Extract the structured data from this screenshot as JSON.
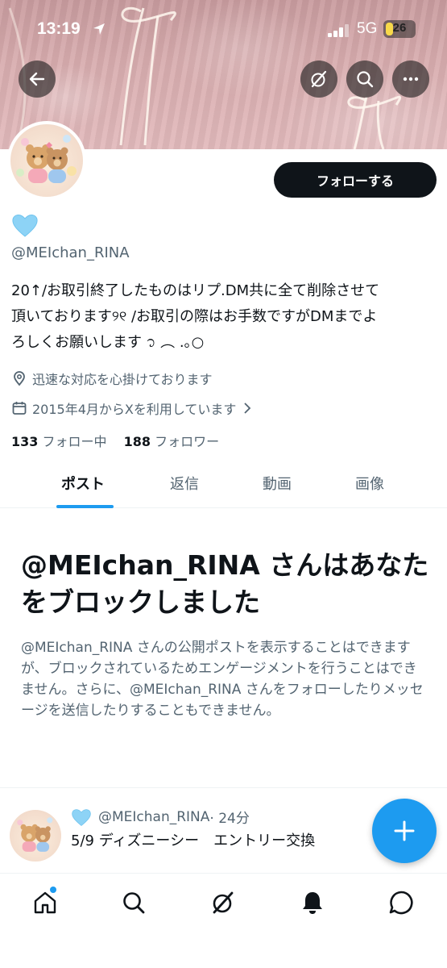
{
  "status_bar": {
    "time": "13:19",
    "network": "5G",
    "battery": "26",
    "battery_level": 0.26
  },
  "header": {
    "back_icon": "arrow-left-icon",
    "actions": [
      "grok-icon",
      "search-icon",
      "more-icon"
    ]
  },
  "profile": {
    "follow_label": "フォローする",
    "emoji": "💙",
    "handle": "@MEIchan_RINA",
    "bio_lines": [
      "20↑/お取引終了したものはリプ.DM共に全て削除させて",
      "頂いております୨୧ /お取引の際はお手数ですがDMまでよ",
      "ろしくお願いします ᭡ ︵ .｡○"
    ],
    "location": "迅速な対応を心掛けております",
    "joined": "2015年4月からXを利用しています",
    "following_count": "133",
    "following_label": "フォロー中",
    "followers_count": "188",
    "followers_label": "フォロワー"
  },
  "tabs": [
    "ポスト",
    "返信",
    "動画",
    "画像"
  ],
  "blocked": {
    "title": "@MEIchan_RINA さんはあなたをブロックしました",
    "description": "@MEIchan_RINA さんの公開ポストを表示することはできますが、ブロックされているためエンゲージメントを行うことはできません。さらに、@MEIchan_RINA さんをフォローしたりメッセージを送信したりすることもできません。"
  },
  "tweet": {
    "emoji": "💙",
    "handle": "@MEIchan_RINA",
    "time": "· 24分",
    "text": "5/9 ディズニーシー　エントリー交換"
  },
  "fab_icon": "compose-plus-icon",
  "bottom_nav": [
    "home-icon",
    "search-icon",
    "grok-icon",
    "notifications-icon",
    "messages-icon"
  ],
  "colors": {
    "accent": "#1d9bf0",
    "text": "#0f1419",
    "secondary": "#536471"
  }
}
